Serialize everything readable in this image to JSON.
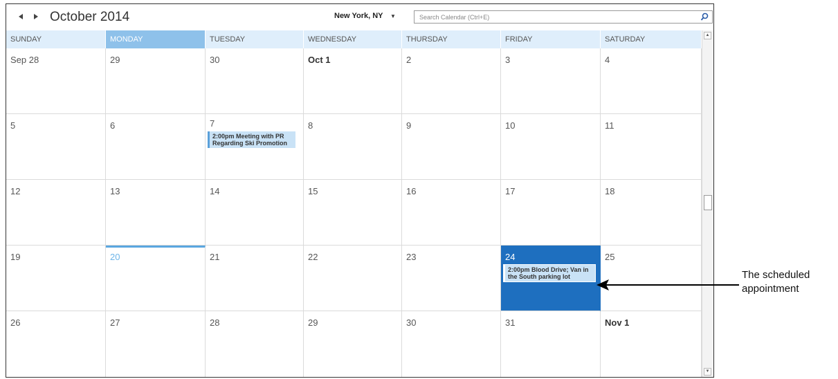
{
  "header": {
    "month_title": "October 2014",
    "location": "New York, NY",
    "search_placeholder": "Search Calendar (Ctrl+E)"
  },
  "weekdays": [
    "SUNDAY",
    "MONDAY",
    "TUESDAY",
    "WEDNESDAY",
    "THURSDAY",
    "FRIDAY",
    "SATURDAY"
  ],
  "weeks": [
    [
      "Sep 28",
      "29",
      "30",
      "Oct 1",
      "2",
      "3",
      "4"
    ],
    [
      "5",
      "6",
      "7",
      "8",
      "9",
      "10",
      "11"
    ],
    [
      "12",
      "13",
      "14",
      "15",
      "16",
      "17",
      "18"
    ],
    [
      "19",
      "20",
      "21",
      "22",
      "23",
      "24",
      "25"
    ],
    [
      "26",
      "27",
      "28",
      "29",
      "30",
      "31",
      "Nov 1"
    ]
  ],
  "appointments": {
    "pr_meeting": "2:00pm Meeting with PR Regarding Ski Promotion",
    "blood_drive": "2:00pm Blood Drive; Van in the South parking lot"
  },
  "callout": {
    "line1": "The scheduled",
    "line2": "appointment"
  },
  "colors": {
    "header_bg": "#dfeefb",
    "today_header": "#8ec1ea",
    "selected_day": "#1e6fbf",
    "appointment": "#c9e2f6"
  }
}
